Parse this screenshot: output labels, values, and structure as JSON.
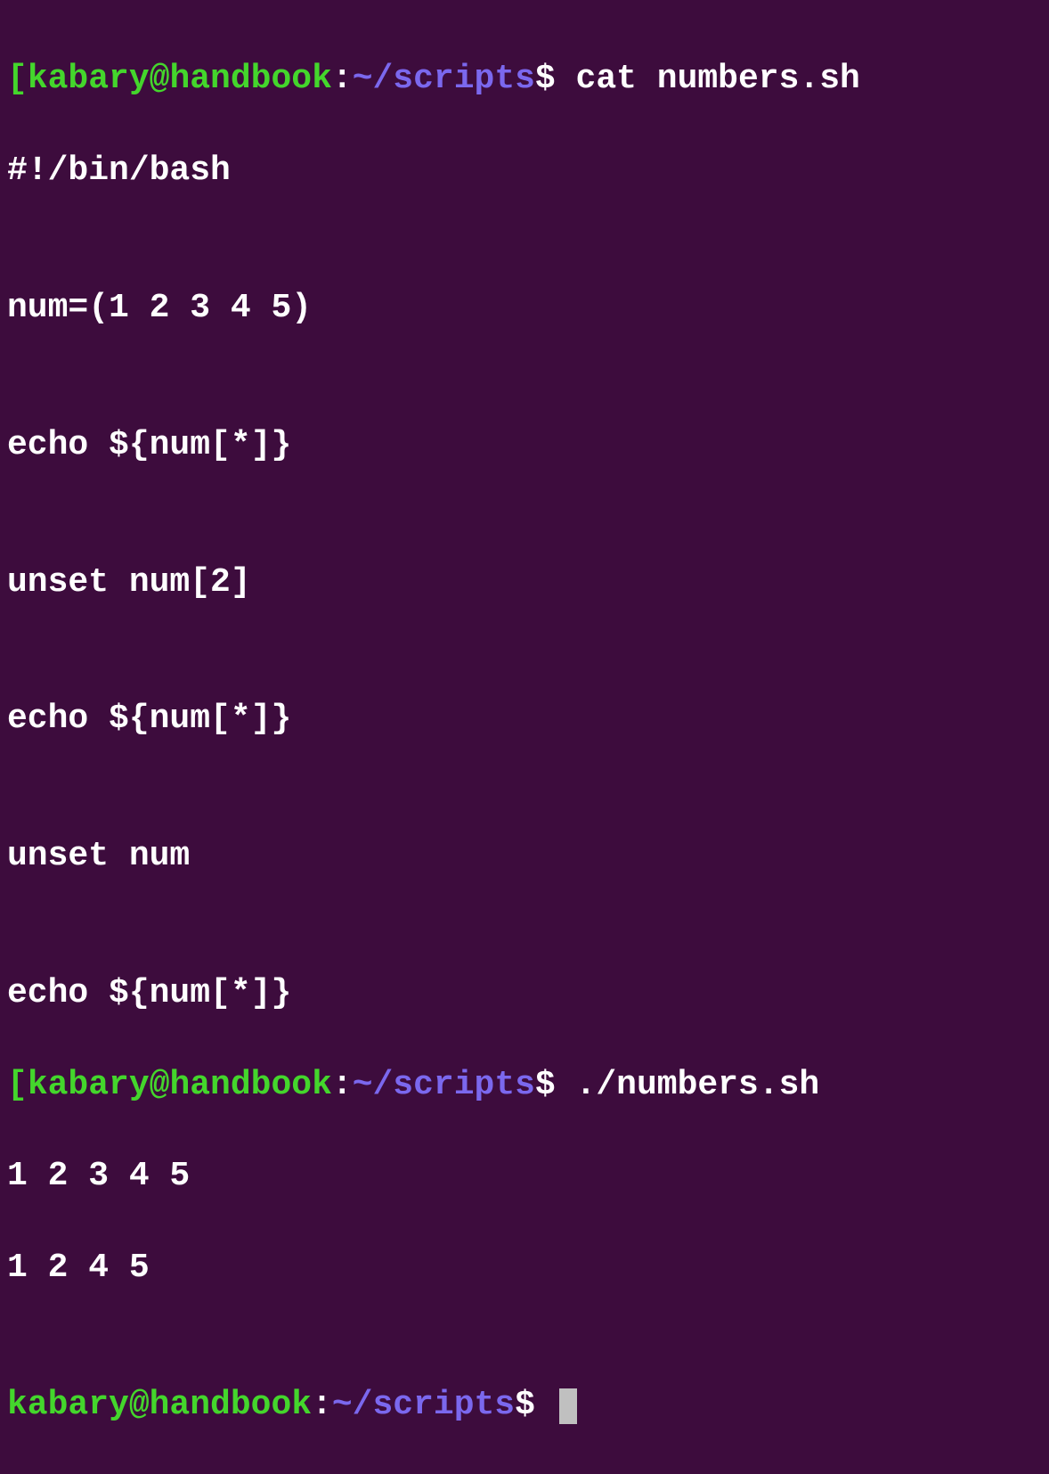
{
  "prompt": {
    "bracket_open": "[",
    "user_host": "kabary@handbook",
    "colon": ":",
    "path": "~/scripts",
    "dollar": "$"
  },
  "commands": {
    "cmd1": "cat numbers.sh",
    "cmd2": "./numbers.sh"
  },
  "script": {
    "line1": "#!/bin/bash",
    "line2": "",
    "line3": "num=(1 2 3 4 5)",
    "line4": "",
    "line5": "echo ${num[*]}",
    "line6": "",
    "line7": "unset num[2]",
    "line8": "",
    "line9": "echo ${num[*]}",
    "line10": "",
    "line11": "unset num",
    "line12": "",
    "line13": "echo ${num[*]}"
  },
  "output": {
    "line1": "1 2 3 4 5",
    "line2": "1 2 4 5",
    "line3": ""
  }
}
